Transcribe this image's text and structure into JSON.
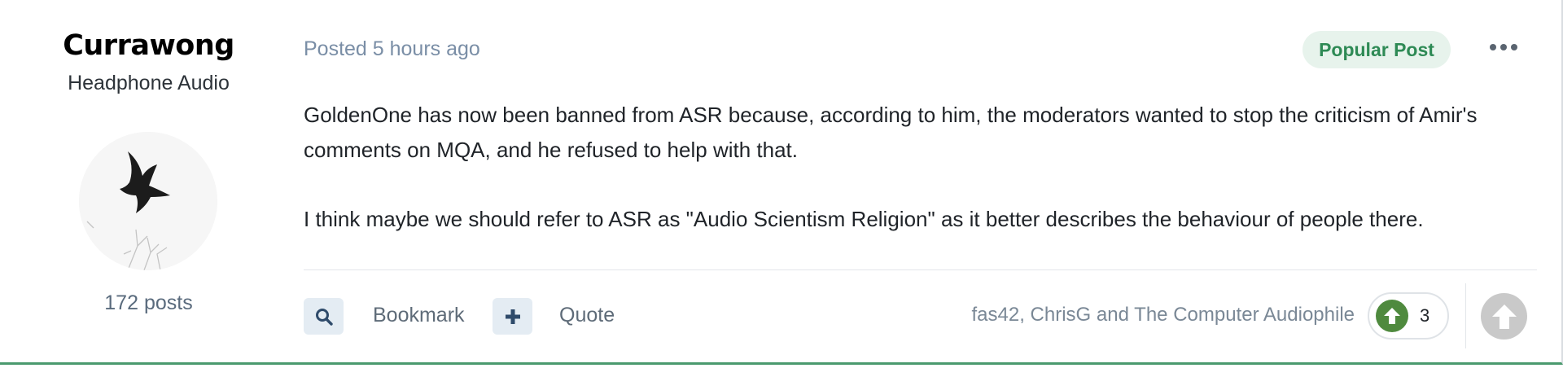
{
  "author": {
    "name": "Currawong",
    "title": "Headphone Audio",
    "posts": "172 posts"
  },
  "post": {
    "posted": "Posted 5 hours ago",
    "badge": "Popular Post",
    "paragraphs": [
      "GoldenOne has now been banned from ASR because, according to him, the moderators wanted to stop the criticism of Amir's comments on MQA, and he refused to help with that.",
      "I think maybe we should refer to ASR as \"Audio Scientism Religion\" as it better describes the behaviour of people there."
    ]
  },
  "toolbar": {
    "bookmark_label": "Bookmark",
    "quote_label": "Quote",
    "reacted_by": "fas42, ChrisG and The Computer Audiophile",
    "reaction_count": "3"
  },
  "icons": {
    "bookmark": "search-icon",
    "quote": "plus-icon",
    "reaction": "upvote-icon",
    "more": "ellipsis-icon",
    "vote": "upvote-icon"
  },
  "colors": {
    "accent_green": "#4a9a6e",
    "badge_bg": "#e7f3ec",
    "badge_text": "#2e8a55",
    "reaction_green": "#4f8a3e",
    "muted_text": "#7a8ea6"
  }
}
